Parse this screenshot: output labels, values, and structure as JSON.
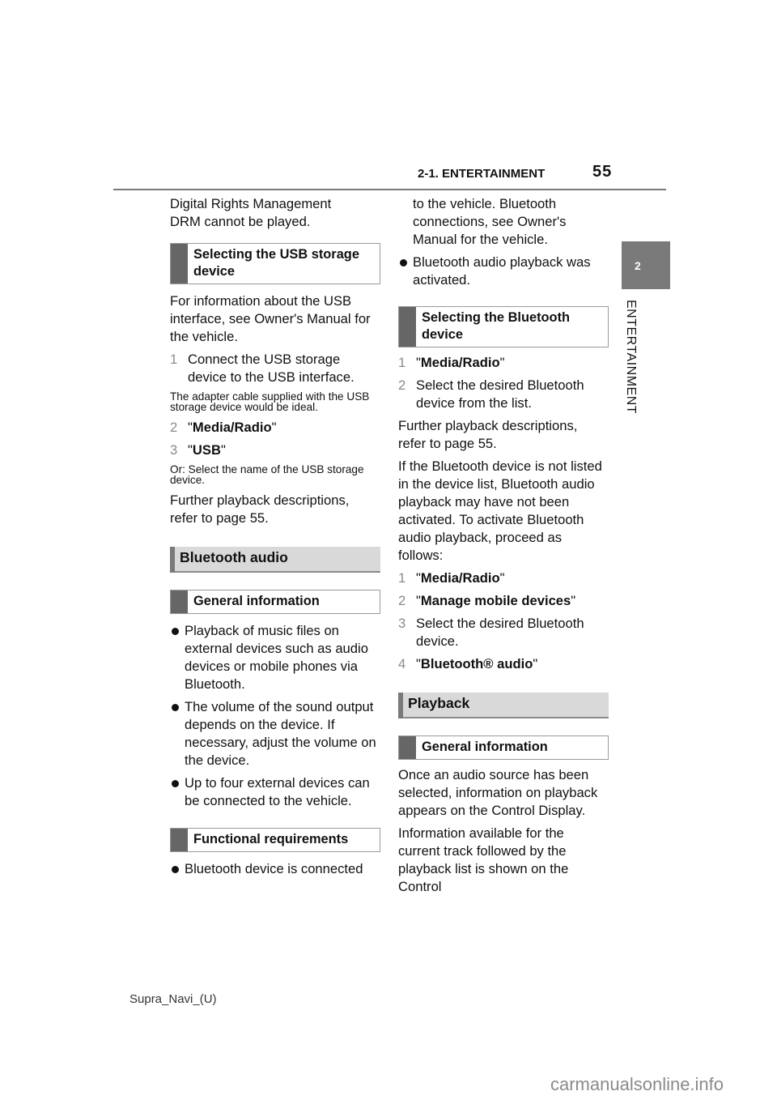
{
  "header": {
    "section": "2-1. ENTERTAINMENT",
    "page_number": "55"
  },
  "side_tab": {
    "chapter_number": "2",
    "chapter_label": "ENTERTAINMENT"
  },
  "left_column": {
    "intro": "Digital Rights Management DRM cannot be played.",
    "usb_heading": "Selecting the USB storage device",
    "usb_paragraph": "For information about the USB interface, see Owner's Manual for the vehicle.",
    "usb_steps": [
      {
        "num": "1",
        "text": "Connect the USB storage device to the USB interface."
      },
      {
        "num": "2",
        "label": "Media/Radio"
      },
      {
        "num": "3",
        "label": "USB"
      }
    ],
    "usb_note_1": "The adapter cable supplied with the USB storage device would be ideal.",
    "usb_note_2": "Or: Select the name of the USB storage device.",
    "usb_further": "Further playback descriptions, refer to page 55.",
    "bt_heading": "Bluetooth audio",
    "general_heading": "General information",
    "general_bullets": [
      "Playback of music files on external devices such as audio devices or mobile phones via Bluetooth.",
      "The volume of the sound output depends on the device. If necessary, adjust the volume on the device.",
      "Up to four external devices can be connected to the vehicle."
    ],
    "functional_heading": "Functional requirements",
    "functional_bullet_start": "Bluetooth device is connected"
  },
  "right_column": {
    "functional_bullet_cont": "to the vehicle. Bluetooth connections, see Owner's Manual for the vehicle.",
    "functional_bullet_2": "Bluetooth audio playback was activated.",
    "select_bt_heading": "Selecting the Bluetooth device",
    "select_steps": [
      {
        "num": "1",
        "label": "Media/Radio"
      },
      {
        "num": "2",
        "text": "Select the desired Bluetooth device from the list."
      }
    ],
    "select_further": "Further playback descriptions, refer to page 55.",
    "not_listed": "If the Bluetooth device is not listed in the device list, Bluetooth audio playback may have not been activated. To activate Bluetooth audio playback, proceed as follows:",
    "activate_steps": [
      {
        "num": "1",
        "label": "Media/Radio"
      },
      {
        "num": "2",
        "label": "Manage mobile devices"
      },
      {
        "num": "3",
        "text": "Select the desired Bluetooth device."
      },
      {
        "num": "4",
        "label": "Bluetooth® audio"
      }
    ],
    "playback_heading": "Playback",
    "playback_general_heading": "General information",
    "playback_p1": "Once an audio source has been selected, information on playback appears on the Control Display.",
    "playback_p2": "Information available for the current track followed by the playback list is shown on the Control"
  },
  "footer": {
    "document_id": "Supra_Navi_(U)",
    "watermark": "carmanualsonline.info"
  }
}
